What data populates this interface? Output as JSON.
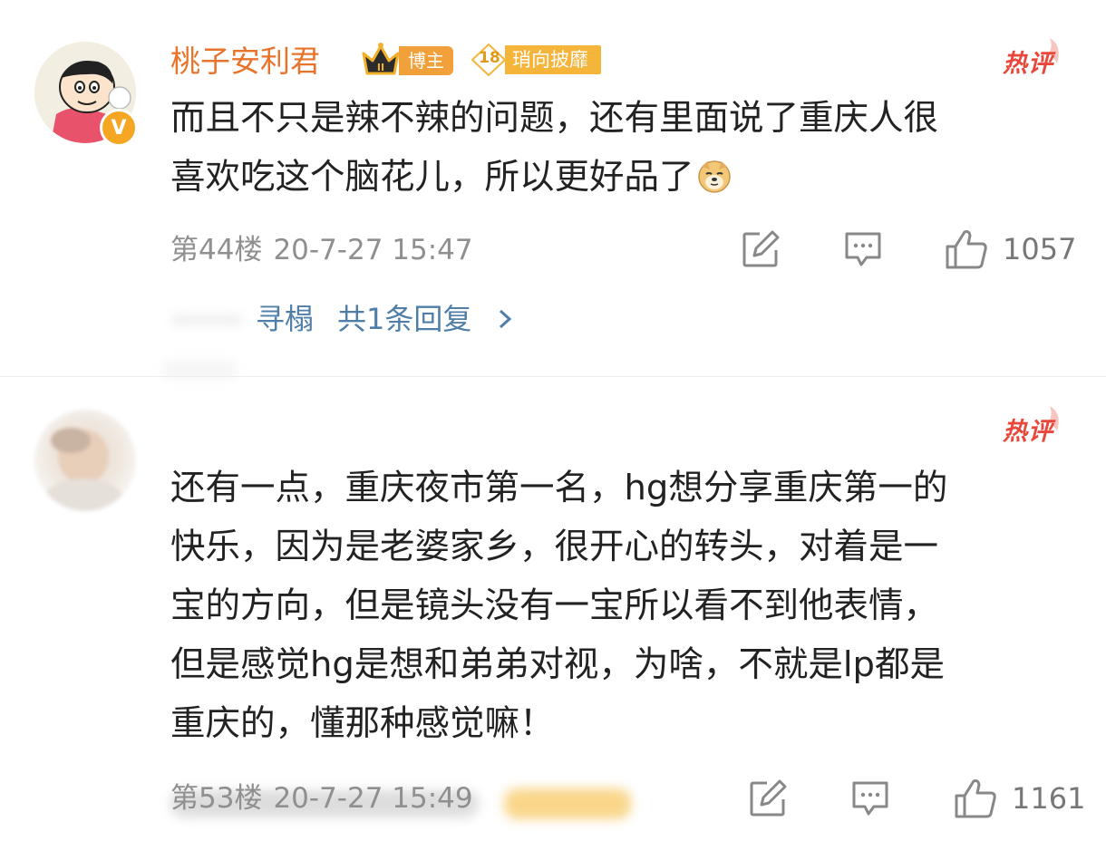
{
  "comments": [
    {
      "username": "桃子安利君",
      "role_badge": "博主",
      "fan_level": "18",
      "fan_label": "琑向披靡",
      "hot_label": "热评",
      "text_before_emoji": "而且不只是辣不辣的问题，还有里面说了重庆人很\n喜欢吃这个脑花儿，所以更好品了",
      "emoji_icon": "doge-emoji",
      "floor": "第44楼",
      "time": "20-7-27 15:47",
      "likes": "1057",
      "reply_user": "寻榻",
      "reply_count": "共1条回复"
    },
    {
      "hot_label": "热评",
      "text": "还有一点，重庆夜市第一名，hg想分享重庆第一的\n快乐，因为是老婆家乡，很开心的转头，对着是一\n宝的方向，但是镜头没有一宝所以看不到他表情，\n但是感觉hg是想和弟弟对视，为啥，不就是lp都是\n重庆的，懂那种感觉嘛！",
      "floor": "第53楼",
      "time": "20-7-27 15:49",
      "likes": "1161"
    }
  ],
  "colors": {
    "username": "#e8742b",
    "hot": "#e8483b",
    "reply_link": "#4f7fa8",
    "meta": "#8f8f8f"
  }
}
